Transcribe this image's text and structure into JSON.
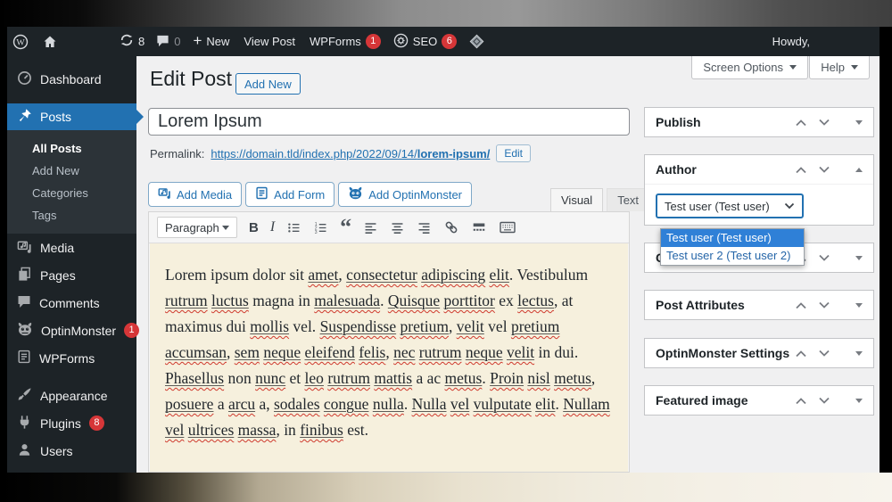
{
  "admin_bar": {
    "updates_count": "8",
    "comments_count": "0",
    "new_plus": "+",
    "new_label": "New",
    "view_post_label": "View Post",
    "wpforms_label": "WPForms",
    "wpforms_badge": "1",
    "seo_label": "SEO",
    "seo_badge": "6",
    "howdy": "Howdy,"
  },
  "sidebar": {
    "dashboard": "Dashboard",
    "posts": "Posts",
    "all_posts": "All Posts",
    "add_new": "Add New",
    "categories": "Categories",
    "tags": "Tags",
    "media": "Media",
    "pages": "Pages",
    "comments": "Comments",
    "optinmonster": "OptinMonster",
    "optinmonster_badge": "1",
    "wpforms": "WPForms",
    "appearance": "Appearance",
    "plugins": "Plugins",
    "plugins_badge": "8",
    "users": "Users"
  },
  "header": {
    "title": "Edit Post",
    "add_new_label": "Add New",
    "screen_options_label": "Screen Options",
    "help_label": "Help"
  },
  "post": {
    "title_value": "Lorem Ipsum",
    "permalink_label": "Permalink:",
    "permalink_url_prefix": "https://domain.tld/index.php/2022/09/14/",
    "permalink_slug": "lorem-ipsum/",
    "edit_button": "Edit"
  },
  "media_buttons": {
    "add_media": "Add Media",
    "add_form": "Add Form",
    "add_optinmonster": "Add OptinMonster"
  },
  "editor": {
    "visual_tab": "Visual",
    "text_tab": "Text",
    "paragraph_dropdown": "Paragraph",
    "toolbar": {
      "bold": "B",
      "italic": "I",
      "quote": "“"
    },
    "tokens": [
      {
        "t": "Lorem ipsum dolor sit "
      },
      {
        "t": "amet",
        "sp": true
      },
      {
        "t": ", "
      },
      {
        "t": "consectetur",
        "sp": true
      },
      {
        "t": " "
      },
      {
        "t": "adipiscing",
        "sp": true
      },
      {
        "t": " "
      },
      {
        "t": "elit",
        "sp": true
      },
      {
        "t": ". Vestibulum "
      },
      {
        "t": "rutrum",
        "sp": true
      },
      {
        "t": " "
      },
      {
        "t": "luctus",
        "sp": true
      },
      {
        "t": " magna in "
      },
      {
        "t": "malesuada",
        "sp": true
      },
      {
        "t": ". "
      },
      {
        "t": "Quisque",
        "sp": true
      },
      {
        "t": " "
      },
      {
        "t": "porttitor",
        "sp": true
      },
      {
        "t": " ex "
      },
      {
        "t": "lectus",
        "sp": true
      },
      {
        "t": ", at maximus dui "
      },
      {
        "t": "mollis",
        "sp": true
      },
      {
        "t": " vel. "
      },
      {
        "t": "Suspendisse",
        "sp": true
      },
      {
        "t": " "
      },
      {
        "t": "pretium",
        "sp": true
      },
      {
        "t": ", "
      },
      {
        "t": "velit",
        "sp": true
      },
      {
        "t": " vel "
      },
      {
        "t": "pretium",
        "sp": true
      },
      {
        "t": " "
      },
      {
        "t": "accumsan",
        "sp": true
      },
      {
        "t": ", "
      },
      {
        "t": "sem",
        "sp": true
      },
      {
        "t": " "
      },
      {
        "t": "neque",
        "sp": true
      },
      {
        "t": " "
      },
      {
        "t": "eleifend",
        "sp": true
      },
      {
        "t": " "
      },
      {
        "t": "felis",
        "sp": true
      },
      {
        "t": ", "
      },
      {
        "t": "nec",
        "sp": true
      },
      {
        "t": " "
      },
      {
        "t": "rutrum",
        "sp": true
      },
      {
        "t": " "
      },
      {
        "t": "neque",
        "sp": true
      },
      {
        "t": " "
      },
      {
        "t": "velit",
        "sp": true
      },
      {
        "t": " in dui. "
      },
      {
        "t": "Phasellus",
        "sp": true
      },
      {
        "t": " non "
      },
      {
        "t": "nunc",
        "sp": true
      },
      {
        "t": " et "
      },
      {
        "t": "leo",
        "sp": true
      },
      {
        "t": " "
      },
      {
        "t": "rutrum",
        "sp": true
      },
      {
        "t": " "
      },
      {
        "t": "mattis",
        "sp": true
      },
      {
        "t": " a ac "
      },
      {
        "t": "metus",
        "sp": true
      },
      {
        "t": ". "
      },
      {
        "t": "Proin",
        "sp": true
      },
      {
        "t": " "
      },
      {
        "t": "nisl",
        "sp": true
      },
      {
        "t": " "
      },
      {
        "t": "metus",
        "sp": true
      },
      {
        "t": ", "
      },
      {
        "t": "posuere",
        "sp": true
      },
      {
        "t": " a "
      },
      {
        "t": "arcu",
        "sp": true
      },
      {
        "t": " a, "
      },
      {
        "t": "sodales",
        "sp": true
      },
      {
        "t": " "
      },
      {
        "t": "congue",
        "sp": true
      },
      {
        "t": " "
      },
      {
        "t": "nulla",
        "sp": true
      },
      {
        "t": ". "
      },
      {
        "t": "Nulla",
        "sp": true
      },
      {
        "t": " "
      },
      {
        "t": "vel",
        "sp": true
      },
      {
        "t": " "
      },
      {
        "t": "vulputate",
        "sp": true
      },
      {
        "t": " "
      },
      {
        "t": "elit",
        "sp": true
      },
      {
        "t": ". "
      },
      {
        "t": "Nullam",
        "sp": true
      },
      {
        "t": " "
      },
      {
        "t": "vel",
        "sp": true
      },
      {
        "t": " "
      },
      {
        "t": "ultrices",
        "sp": true
      },
      {
        "t": " "
      },
      {
        "t": "massa",
        "sp": true
      },
      {
        "t": ", in "
      },
      {
        "t": "finibus",
        "sp": true
      },
      {
        "t": " est."
      }
    ]
  },
  "panels": {
    "publish": "Publish",
    "author": "Author",
    "author_select_value": "Test user (Test user)",
    "author_options": [
      "Test user (Test user)",
      "Test user 2 (Test user 2)"
    ],
    "categories_title": "Categories",
    "post_attributes": "Post Attributes",
    "optinmonster_settings": "OptinMonster Settings",
    "featured_image": "Featured image"
  },
  "colors": {
    "accent_blue": "#2271b1",
    "badge_red": "#d63638",
    "admin_dark": "#1d2327",
    "editor_paper": "#f6f0dd",
    "select_highlight": "#2f80d7"
  }
}
